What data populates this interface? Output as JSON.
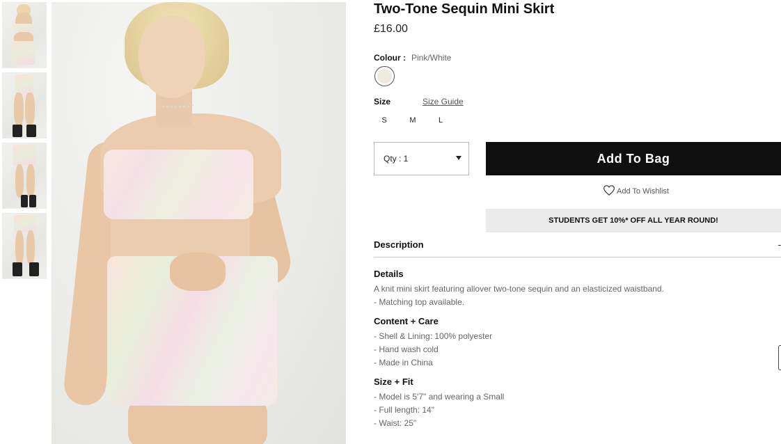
{
  "product": {
    "title": "Two-Tone Sequin Mini Skirt",
    "price": "£16.00"
  },
  "colour": {
    "label": "Colour :",
    "value": "Pink/White"
  },
  "size": {
    "label": "Size",
    "guide_link": "Size Guide",
    "options": [
      "S",
      "M",
      "L"
    ]
  },
  "purchase": {
    "qty_label": "Qty : 1",
    "add_to_bag": "Add To Bag",
    "wishlist": "Add To Wishlist",
    "promo": "STUDENTS GET 10%* OFF ALL YEAR ROUND!"
  },
  "description": {
    "header": "Description",
    "toggle": "-",
    "details_title": "Details",
    "details_lines": [
      "A knit mini skirt featuring allover two-tone sequin and an elasticized waistband.",
      "- Matching top available."
    ],
    "care_title": "Content + Care",
    "care_lines": [
      "- Shell & Lining: 100% polyester",
      "- Hand wash cold",
      "- Made in China"
    ],
    "fit_title": "Size + Fit",
    "fit_lines": [
      "- Model is 5'7\" and wearing a Small",
      "- Full length: 14\"",
      "- Waist: 25\""
    ]
  },
  "icons": {
    "wishlist": "heart-icon",
    "qty": "caret-down-icon"
  },
  "colors": {
    "primary_button": "#0f0f0f",
    "promo_bg": "#ebebeb"
  }
}
